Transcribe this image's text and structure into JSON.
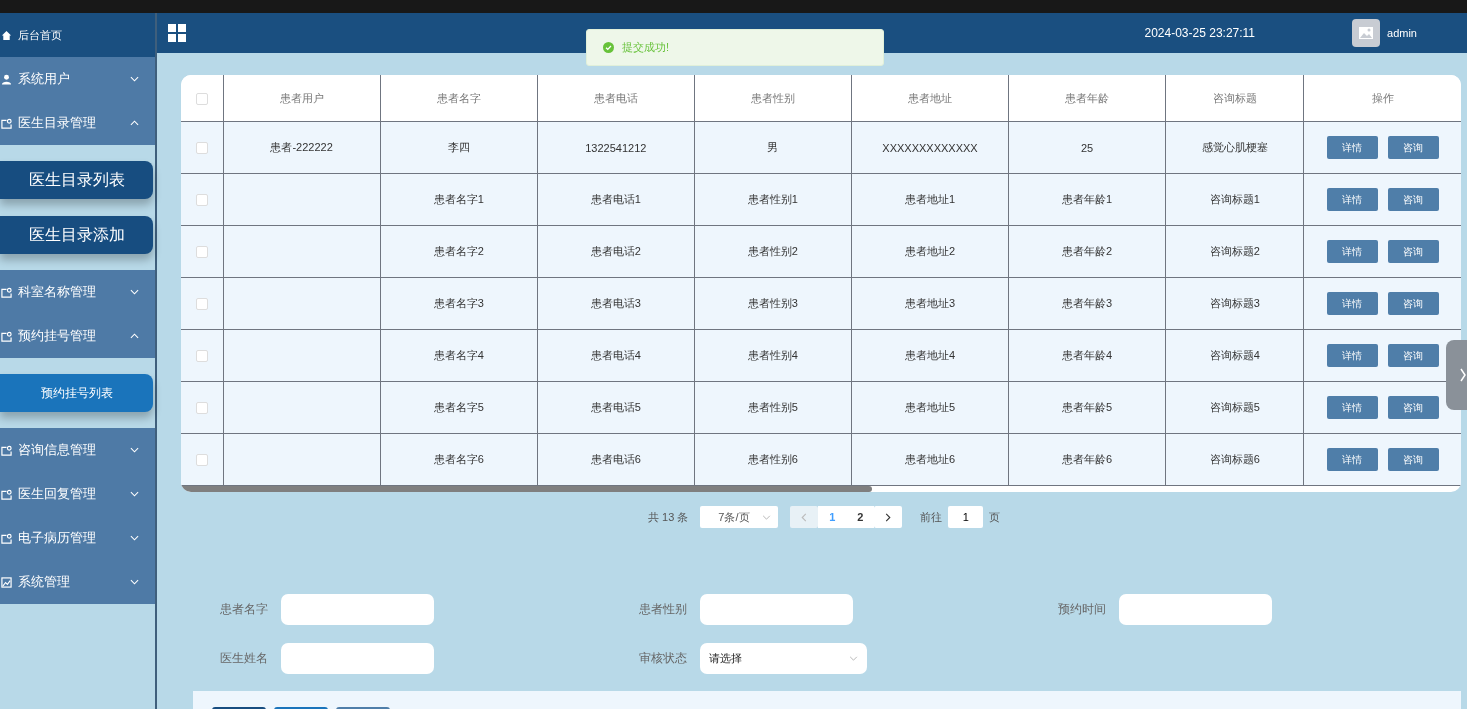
{
  "sidebar": {
    "items": [
      {
        "label": "后台首页",
        "kind": "link"
      },
      {
        "label": "系统用户",
        "kind": "group",
        "expanded": false
      },
      {
        "label": "医生目录管理",
        "kind": "group",
        "expanded": true,
        "children": [
          {
            "label": "医生目录列表",
            "selected": false
          },
          {
            "label": "医生目录添加",
            "selected": false
          }
        ]
      },
      {
        "label": "科室名称管理",
        "kind": "group",
        "expanded": false
      },
      {
        "label": "预约挂号管理",
        "kind": "group",
        "expanded": true,
        "children": [
          {
            "label": "预约挂号列表",
            "selected": true
          }
        ]
      },
      {
        "label": "咨询信息管理",
        "kind": "group",
        "expanded": false
      },
      {
        "label": "医生回复管理",
        "kind": "group",
        "expanded": false
      },
      {
        "label": "电子病历管理",
        "kind": "group",
        "expanded": false
      },
      {
        "label": "系统管理",
        "kind": "group",
        "expanded": false
      }
    ]
  },
  "header": {
    "datetime": "2024-03-25 23:27:11",
    "user": "admin"
  },
  "toast": {
    "message": "提交成功!"
  },
  "table": {
    "select_all_checked": false,
    "columns": [
      "患者用户",
      "患者名字",
      "患者电话",
      "患者性别",
      "患者地址",
      "患者年龄",
      "咨询标题",
      "操作"
    ],
    "rows": [
      {
        "checked": false,
        "cells": [
          "患者-222222",
          "李四",
          "1322541212",
          "男",
          "XXXXXXXXXXXXX",
          "25",
          "感觉心肌梗塞"
        ],
        "actions": [
          "详情",
          "咨询"
        ]
      },
      {
        "checked": false,
        "cells": [
          "",
          "患者名字1",
          "患者电话1",
          "患者性别1",
          "患者地址1",
          "患者年龄1",
          "咨询标题1"
        ],
        "actions": [
          "详情",
          "咨询"
        ]
      },
      {
        "checked": false,
        "cells": [
          "",
          "患者名字2",
          "患者电话2",
          "患者性别2",
          "患者地址2",
          "患者年龄2",
          "咨询标题2"
        ],
        "actions": [
          "详情",
          "咨询"
        ]
      },
      {
        "checked": false,
        "cells": [
          "",
          "患者名字3",
          "患者电话3",
          "患者性别3",
          "患者地址3",
          "患者年龄3",
          "咨询标题3"
        ],
        "actions": [
          "详情",
          "咨询"
        ]
      },
      {
        "checked": false,
        "cells": [
          "",
          "患者名字4",
          "患者电话4",
          "患者性别4",
          "患者地址4",
          "患者年龄4",
          "咨询标题4"
        ],
        "actions": [
          "详情",
          "咨询"
        ]
      },
      {
        "checked": false,
        "cells": [
          "",
          "患者名字5",
          "患者电话5",
          "患者性别5",
          "患者地址5",
          "患者年龄5",
          "咨询标题5"
        ],
        "actions": [
          "详情",
          "咨询"
        ]
      },
      {
        "checked": false,
        "cells": [
          "",
          "患者名字6",
          "患者电话6",
          "患者性别6",
          "患者地址6",
          "患者年龄6",
          "咨询标题6"
        ],
        "actions": [
          "详情",
          "咨询"
        ]
      }
    ]
  },
  "pagination": {
    "total": "共 13 条",
    "page_size": "7条/页",
    "pages": [
      {
        "label": "1",
        "selected": true
      },
      {
        "label": "2",
        "selected": false
      }
    ],
    "goto_label": "前往",
    "goto_value": "1",
    "goto_suffix": "页"
  },
  "form": {
    "fields": [
      {
        "label": "患者名字",
        "kind": "input"
      },
      {
        "label": "患者性别",
        "kind": "input"
      },
      {
        "label": "预约时间",
        "kind": "input"
      },
      {
        "label": "医生姓名",
        "kind": "input"
      },
      {
        "label": "审核状态",
        "kind": "select",
        "placeholder": "请选择"
      }
    ]
  }
}
